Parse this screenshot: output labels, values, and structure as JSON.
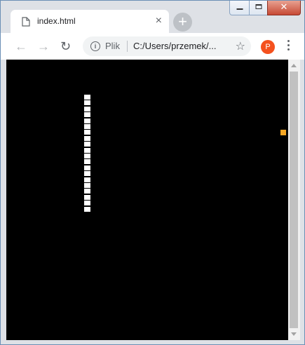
{
  "window": {
    "tab_title": "index.html",
    "tab_close_glyph": "×",
    "new_tab_glyph": "+",
    "close_glyph": "✕"
  },
  "toolbar": {
    "back_glyph": "←",
    "forward_glyph": "→",
    "reload_glyph": "↻",
    "site_info_label": "Plik",
    "url": "C:/Users/przemek/...",
    "bookmark_glyph": "☆",
    "profile_initial": "P"
  },
  "icons": {
    "page": "page-icon",
    "info": "info-icon",
    "star": "star-icon",
    "menu": "kebab-menu-icon"
  },
  "game": {
    "background_color": "#000000",
    "snake_color": "#ffffff",
    "snake_segments": 20,
    "food_color": "#f5a623"
  }
}
